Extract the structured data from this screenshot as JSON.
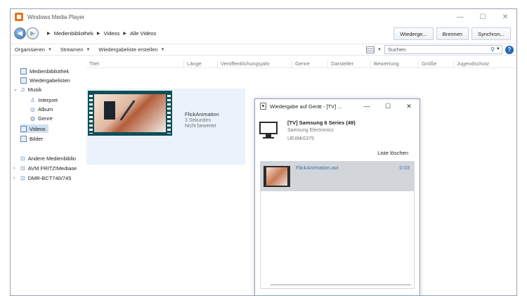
{
  "window": {
    "title": "Windows Media Player"
  },
  "nav": {
    "breadcrumb": [
      "Medienbibliothek",
      "Videos",
      "Alle Videos"
    ],
    "tabs": [
      "Wiederge...",
      "Brennen",
      "Synchron..."
    ]
  },
  "toolbar": {
    "organize": "Organisieren",
    "stream": "Streamen",
    "create_playlist": "Wiedergabeliste erstellen",
    "search_placeholder": "Suchen"
  },
  "sidebar": {
    "items": [
      "Medienbibliothek",
      "Wiedergabelisten",
      "Musik",
      "Interpret",
      "Album",
      "Genre",
      "Videos",
      "Bilder",
      "Andere Medienbiblio",
      "AVM FRITZ!Mediase",
      "DMR-BCT740/745"
    ]
  },
  "columns": [
    "Titel",
    "Länge",
    "Veröffentlichungsjahr",
    "Genre",
    "Darsteller",
    "Bewertung",
    "Größe",
    "Jugendschutz"
  ],
  "video": {
    "title": "FlickAnimation",
    "length": "3 Sekunden",
    "rating": "Nicht bewertet"
  },
  "dialog": {
    "title": "Wiedergabe auf Gerät - [TV] ...",
    "device_name": "[TV] Samsung 6 Series (49)",
    "manufacturer": "Samsung Electronics",
    "model": "UE49K6379",
    "clear_list": "Liste löschen",
    "playlist": [
      {
        "title": "FlickAnimation.avi",
        "duration": "0:03"
      }
    ]
  }
}
